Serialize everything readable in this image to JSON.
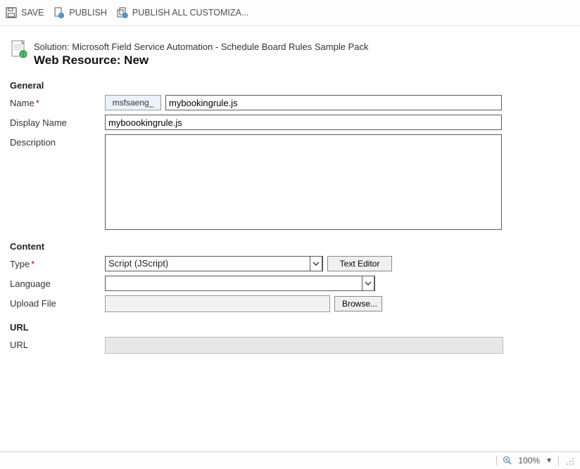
{
  "toolbar": {
    "save": "SAVE",
    "publish": "PUBLISH",
    "publish_all": "PUBLISH ALL CUSTOMIZA..."
  },
  "header": {
    "solution_line": "Solution: Microsoft Field Service Automation - Schedule Board Rules Sample Pack",
    "title": "Web Resource: New"
  },
  "general": {
    "heading": "General",
    "name_label": "Name",
    "name_prefix": "msfsaeng_",
    "name_value": "mybookingrule.js",
    "display_label": "Display Name",
    "display_value": "myboookingrule.js",
    "description_label": "Description",
    "description_value": ""
  },
  "content": {
    "heading": "Content",
    "type_label": "Type",
    "type_value": "Script (JScript)",
    "text_editor_btn": "Text Editor",
    "language_label": "Language",
    "language_value": "",
    "upload_label": "Upload File",
    "upload_value": "",
    "browse_btn": "Browse..."
  },
  "url_section": {
    "heading": "URL",
    "url_label": "URL",
    "url_value": ""
  },
  "status": {
    "zoom": "100%"
  }
}
